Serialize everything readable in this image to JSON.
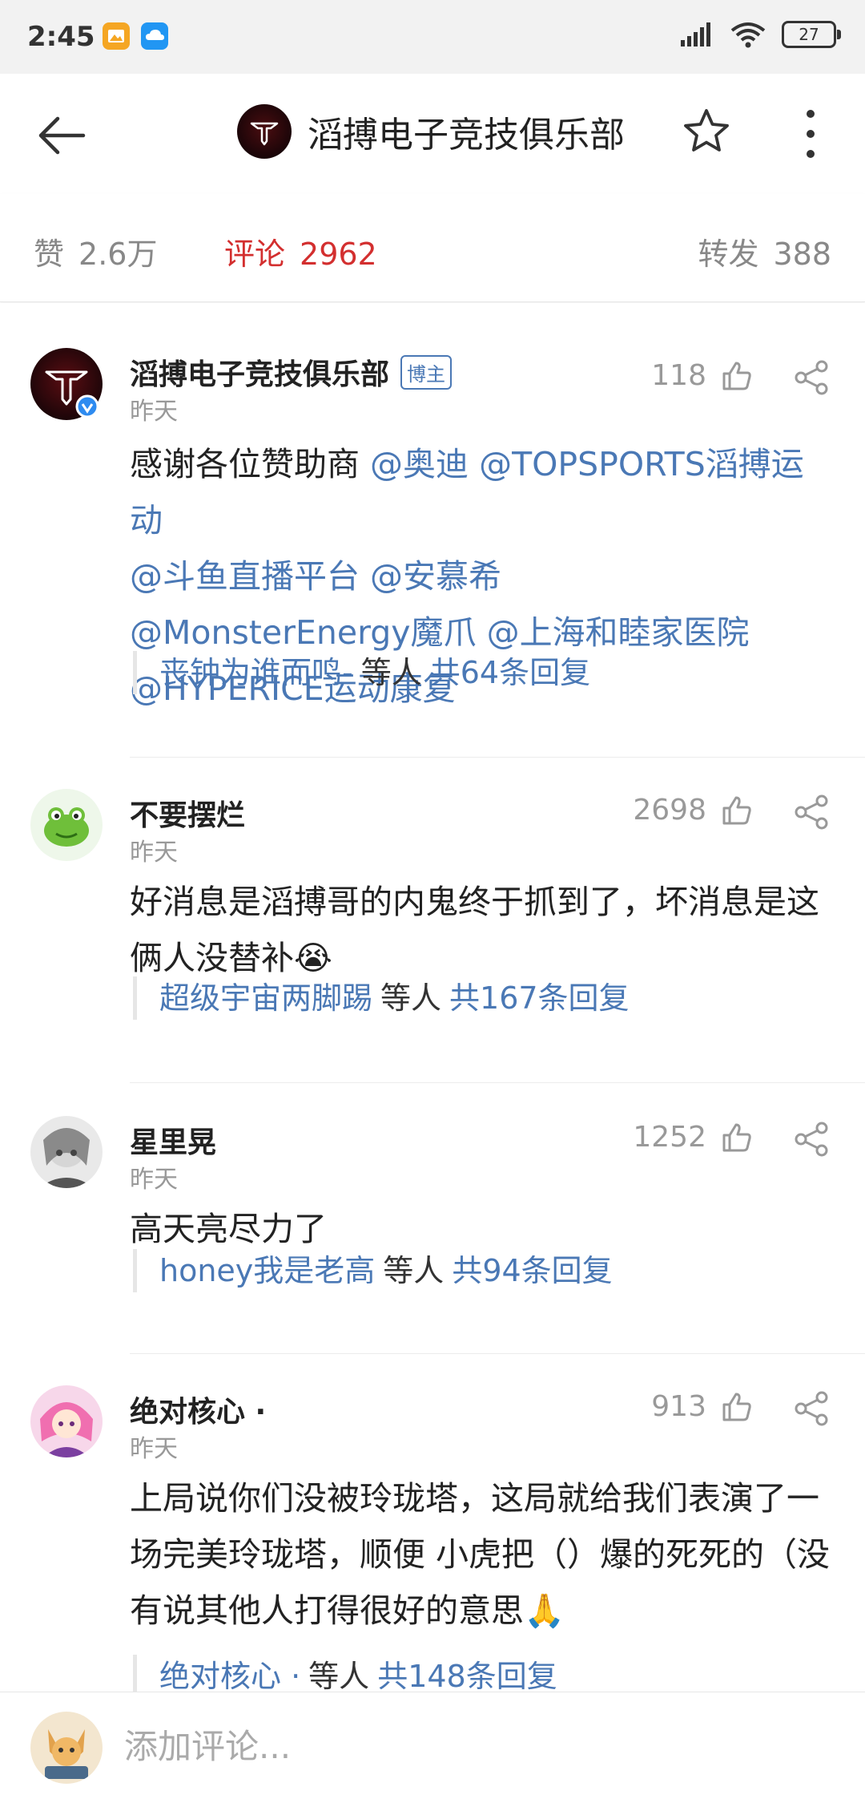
{
  "status_bar": {
    "time": "2:45",
    "battery": "27"
  },
  "header": {
    "title": "滔搏电子竞技俱乐部"
  },
  "stats": {
    "likes_label": "赞",
    "likes_value": "2.6万",
    "comments_label": "评论",
    "comments_value": "2962",
    "reposts_label": "转发",
    "reposts_value": "388"
  },
  "comments": [
    {
      "name": "滔搏电子竞技俱乐部",
      "badge": "博主",
      "time": "昨天",
      "likes": "118",
      "text_plain": "感谢各位赞助商 ",
      "mentions": [
        "@奥迪",
        "@TOPSPORTS滔搏运动",
        "@斗鱼直播平台",
        "@安慕希",
        "@MonsterEnergy魔爪",
        "@上海和睦家医院",
        "@HYPERICE运动康复"
      ],
      "reply_user": "丧钟为谁而鸣-",
      "reply_etc": "等人",
      "reply_count": "共64条回复"
    },
    {
      "name": "不要摆烂",
      "time": "昨天",
      "likes": "2698",
      "text": "好消息是滔搏哥的内鬼终于抓到了，坏消息是这俩人没替补😭",
      "reply_user": "超级宇宙两脚踢",
      "reply_etc": "等人",
      "reply_count": "共167条回复"
    },
    {
      "name": "星里晃",
      "time": "昨天",
      "likes": "1252",
      "text": "高天亮尽力了",
      "reply_user": "honey我是老高",
      "reply_etc": "等人",
      "reply_count": "共94条回复"
    },
    {
      "name": "绝对核心 ·",
      "time": "昨天",
      "likes": "913",
      "text": "上局说你们没被玲珑塔，这局就给我们表演了一场完美玲珑塔，顺便 小虎把（）爆的死死的（没有说其他人打得很好的意思🙏",
      "reply_user": "绝对核心 ·",
      "reply_etc": "等人",
      "reply_count": "共148条回复"
    }
  ],
  "composer": {
    "placeholder": "添加评论..."
  },
  "colors": {
    "accent_red": "#d32f2f",
    "link_blue": "#4a78b5"
  }
}
